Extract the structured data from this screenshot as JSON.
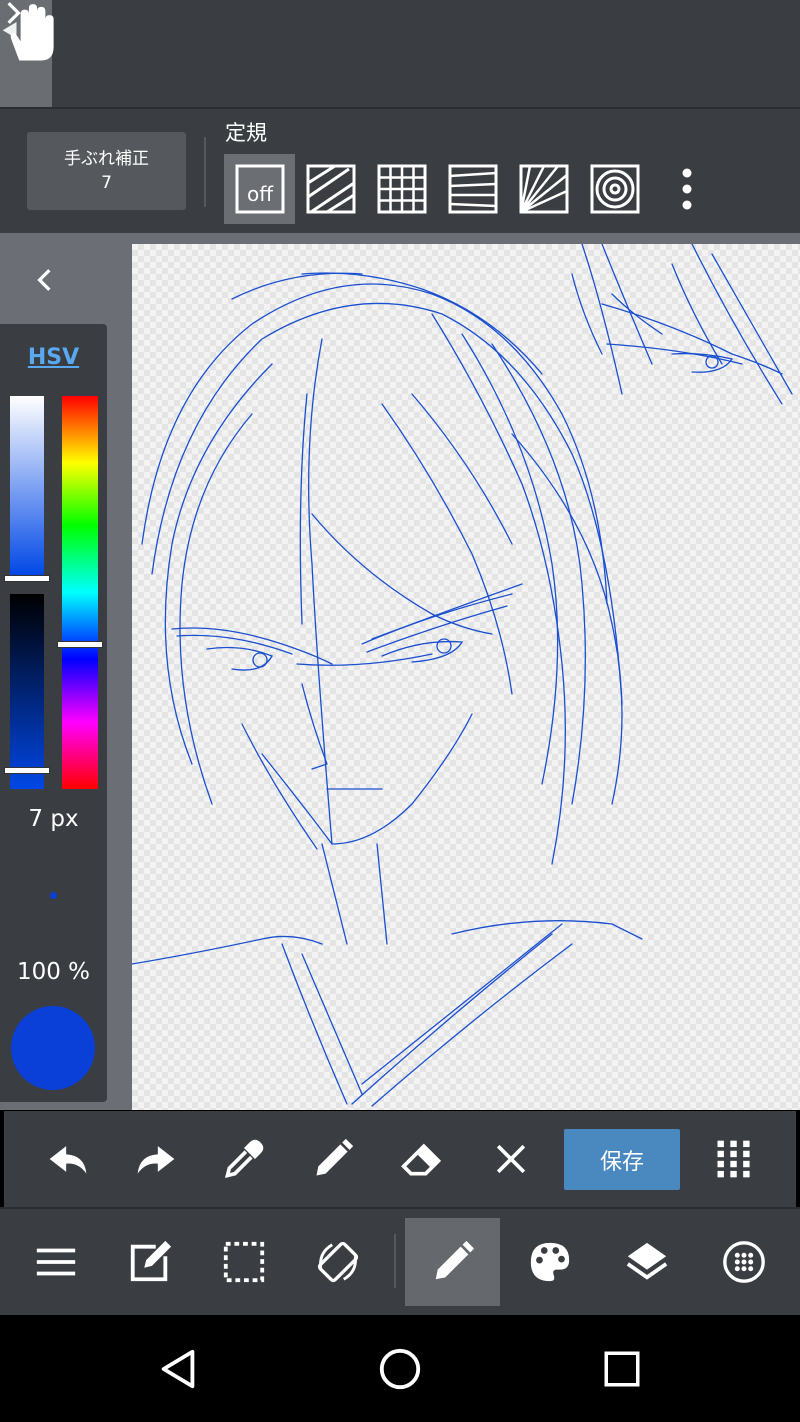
{
  "top_toolbar": {
    "tools": [
      "hand-tool",
      "brush-tool",
      "move-tool",
      "fill-shape-tool",
      "bucket-tool",
      "gradient-tool",
      "select-tool",
      "magic-wand-tool"
    ],
    "more": "chevron-right-icon"
  },
  "ruler": {
    "stabilizer_label": "手ぶれ補正",
    "stabilizer_value": "7",
    "title": "定規",
    "off_label": "off"
  },
  "color_panel": {
    "mode_tab": "HSV",
    "brush_size": "7 px",
    "opacity": "100 %",
    "current_color": "#0a40d8",
    "hue_level": 0.63,
    "saturation_level": 0.0,
    "value_level": 0.0
  },
  "quick_bar": {
    "save_label": "保存"
  },
  "colors": {
    "toolbar_bg": "#3a3d42",
    "accent": "#4a88c0",
    "stroke_blue": "#1a4fd0"
  }
}
